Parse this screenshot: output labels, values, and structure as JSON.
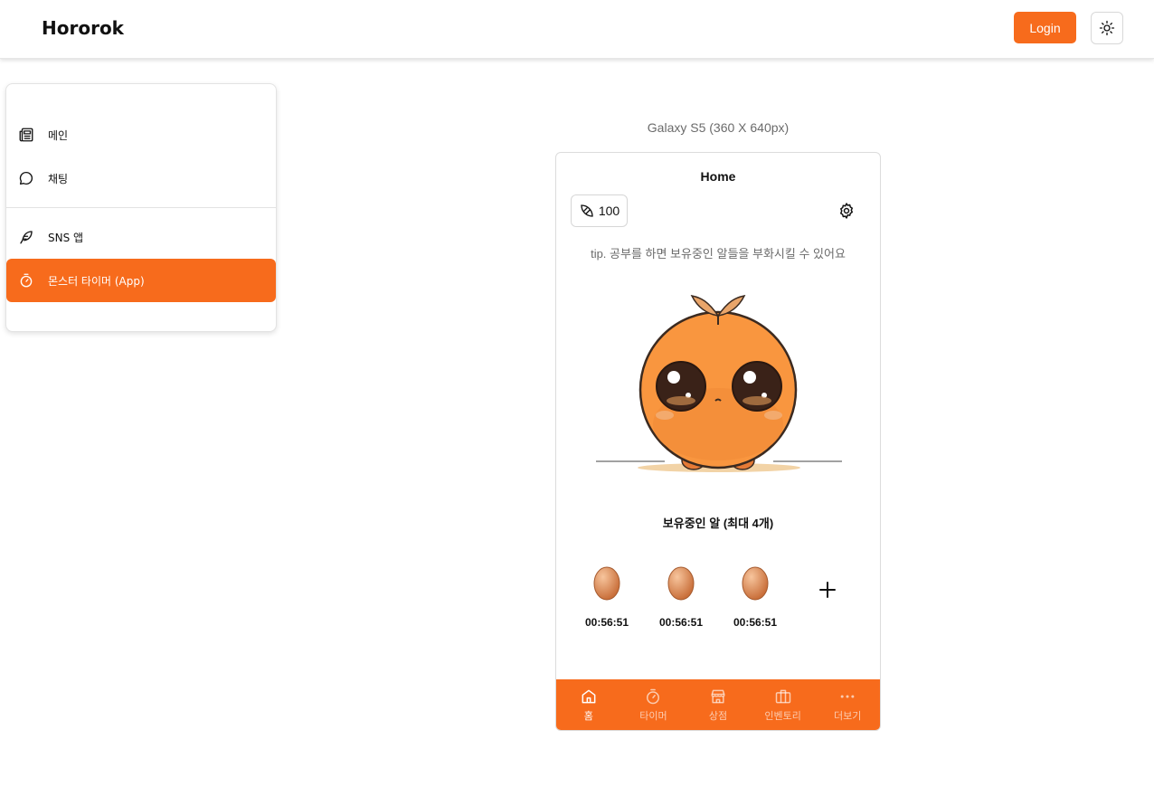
{
  "header": {
    "brand": "Hororok",
    "login_label": "Login",
    "theme_icon": "sun-icon"
  },
  "sidebar": {
    "items": [
      {
        "label": "메인",
        "icon": "newspaper-icon",
        "active": false
      },
      {
        "label": "채팅",
        "icon": "chat-bubble-icon",
        "active": false
      },
      {
        "label": "SNS 앱",
        "icon": "feather-icon",
        "active": false
      },
      {
        "label": "몬스터 타이머 (App)",
        "icon": "stopwatch-icon",
        "active": true
      }
    ]
  },
  "device": {
    "label": "Galaxy S5 (360 X 640px)",
    "title": "Home",
    "coins": "100",
    "tip": "tip. 공부를 하면 보유중인 알들을 부화시킬 수 있어요",
    "eggs_title": "보유중인 알 (최대 4개)",
    "eggs": [
      {
        "time": "00:56:51"
      },
      {
        "time": "00:56:51"
      },
      {
        "time": "00:56:51"
      }
    ],
    "nav": [
      {
        "label": "홈",
        "icon": "home-icon",
        "active": true
      },
      {
        "label": "타이머",
        "icon": "timer-icon",
        "active": false
      },
      {
        "label": "상점",
        "icon": "store-icon",
        "active": false
      },
      {
        "label": "인벤토리",
        "icon": "inventory-icon",
        "active": false
      },
      {
        "label": "더보기",
        "icon": "more-icon",
        "active": false
      }
    ]
  },
  "colors": {
    "accent": "#f76b1c",
    "muted_text": "#6b6b6b"
  }
}
